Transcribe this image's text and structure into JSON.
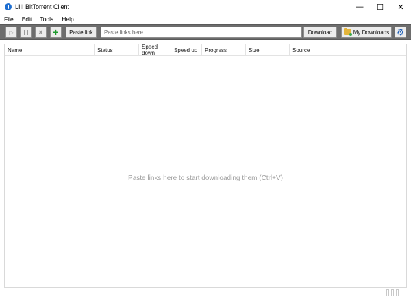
{
  "window": {
    "title": "LIII BitTorrent Client",
    "controls": {
      "minimize": "—",
      "maximize": "☐",
      "close": "✕"
    }
  },
  "menu": [
    "File",
    "Edit",
    "Tools",
    "Help"
  ],
  "toolbar": {
    "paste_link_label": "Paste link",
    "link_input": {
      "placeholder": "Paste links here ...",
      "value": ""
    },
    "download_label": "Download",
    "my_downloads_label": "My Downloads"
  },
  "columns": [
    "Name",
    "Status",
    "Speed down",
    "Speed up",
    "Progress",
    "Size",
    "Source"
  ],
  "empty_message": "Paste links here to start downloading them (Ctrl+V)",
  "colors": {
    "toolbar_bg": "#6d6d6d",
    "add_icon": "#1c9a2c",
    "settings_icon": "#1d5fb8",
    "folder_icon": "#e3b43a"
  }
}
